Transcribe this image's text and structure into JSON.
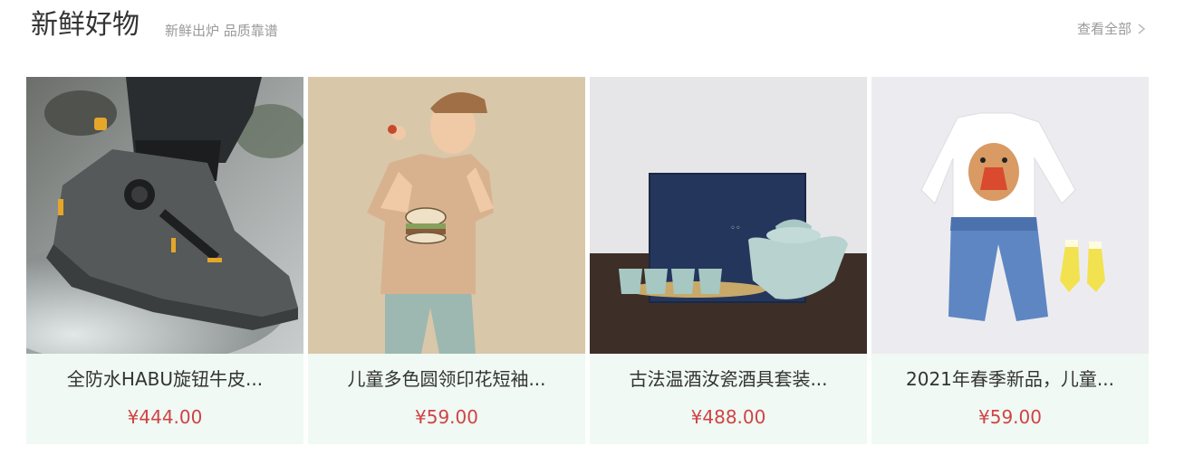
{
  "header": {
    "title": "新鲜好物",
    "subtitle": "新鲜出炉 品质靠谱",
    "view_all": "查看全部"
  },
  "products": [
    {
      "name": "全防水HABU旋钮牛皮...",
      "price": "¥444.00",
      "image": "waterproof-hiking-shoe"
    },
    {
      "name": "儿童多色圆领印花短袖...",
      "price": "¥59.00",
      "image": "child-tshirt"
    },
    {
      "name": "古法温酒汝瓷酒具套装...",
      "price": "¥488.00",
      "image": "celadon-wine-set"
    },
    {
      "name": "2021年春季新品，儿童...",
      "price": "¥59.00",
      "image": "kids-outfit-flatlay"
    }
  ],
  "colors": {
    "card_bg": "#f0f9f4",
    "price": "#cf4444",
    "muted": "#999999"
  }
}
